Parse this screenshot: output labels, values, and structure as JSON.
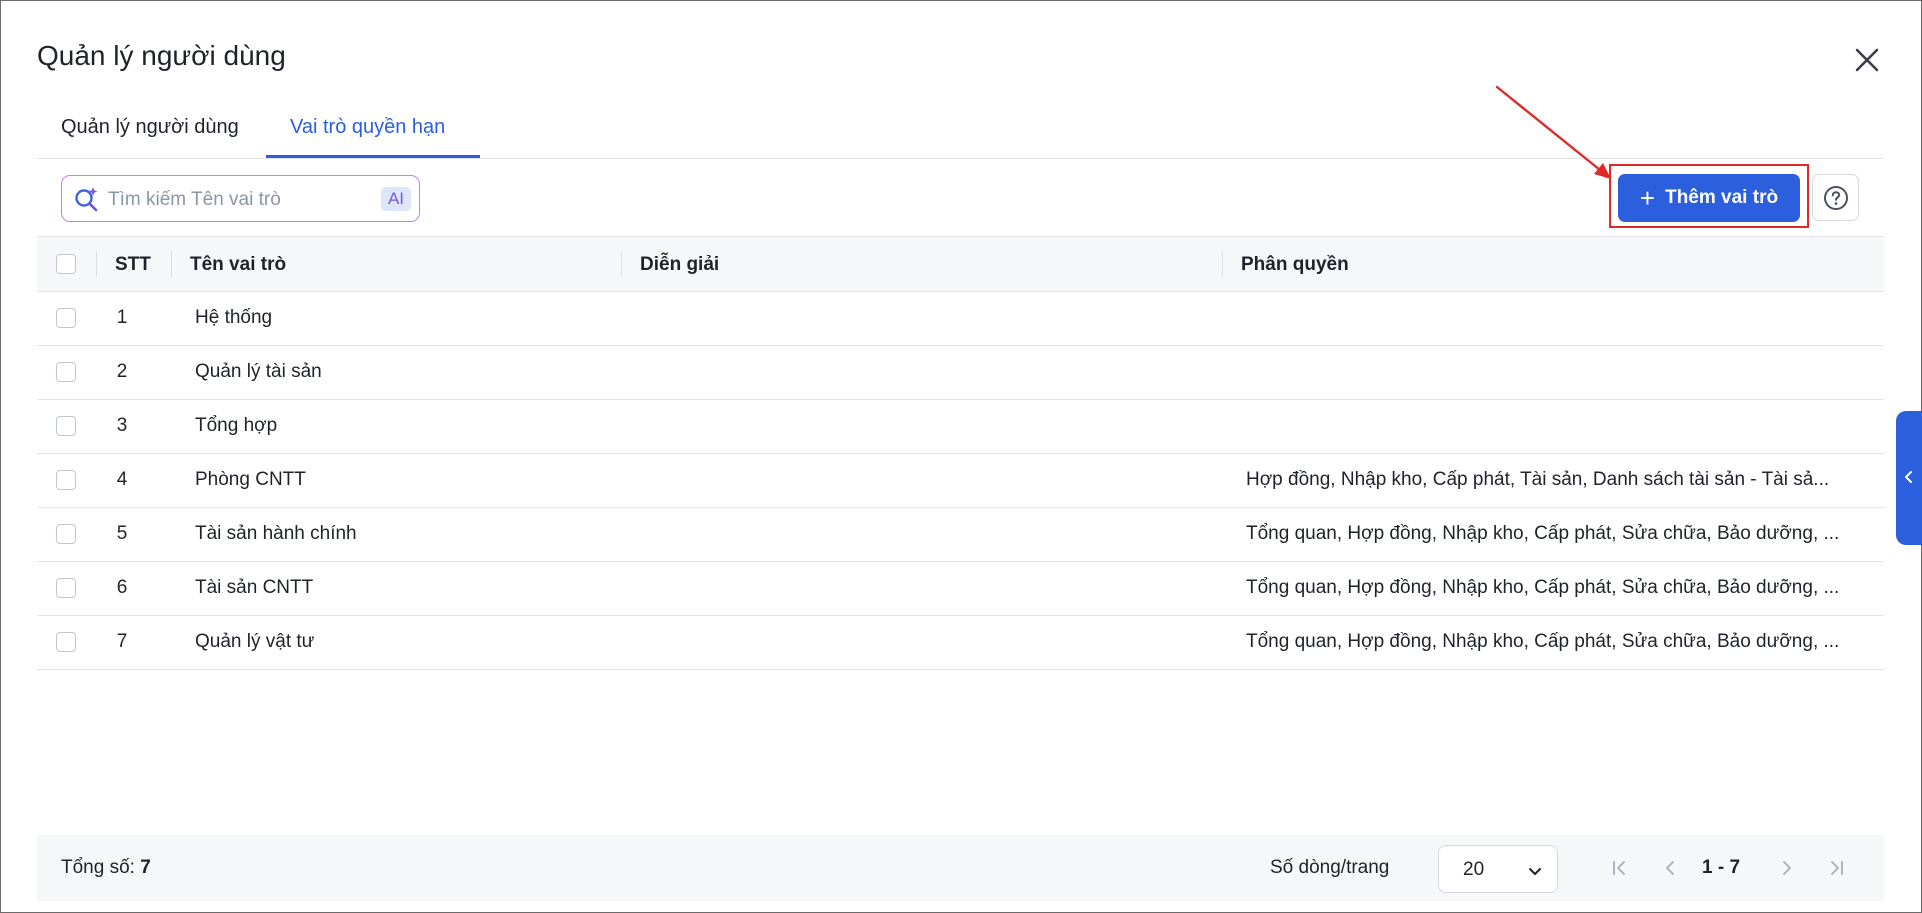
{
  "dialog": {
    "title": "Quản lý người dùng"
  },
  "tabs": [
    {
      "label": "Quản lý người dùng",
      "active": false
    },
    {
      "label": "Vai trò quyền hạn",
      "active": true
    }
  ],
  "search": {
    "placeholder": "Tìm kiếm Tên vai trò",
    "value": "",
    "ai_badge": "AI"
  },
  "toolbar": {
    "add_label": "Thêm vai trò",
    "help_icon": "question-circle-icon"
  },
  "table": {
    "columns": [
      "STT",
      "Tên vai trò",
      "Diễn giải",
      "Phân quyền"
    ],
    "rows": [
      {
        "stt": "1",
        "name": "Hệ thống",
        "description": "",
        "permissions": ""
      },
      {
        "stt": "2",
        "name": "Quản lý tài sản",
        "description": "",
        "permissions": ""
      },
      {
        "stt": "3",
        "name": "Tổng hợp",
        "description": "",
        "permissions": ""
      },
      {
        "stt": "4",
        "name": "Phòng CNTT",
        "description": "",
        "permissions": "Hợp đồng, Nhập kho, Cấp phát, Tài sản, Danh sách tài sản - Tài sả..."
      },
      {
        "stt": "5",
        "name": "Tài sản hành chính",
        "description": "",
        "permissions": "Tổng quan, Hợp đồng, Nhập kho, Cấp phát, Sửa chữa, Bảo dưỡng, ..."
      },
      {
        "stt": "6",
        "name": "Tài sản CNTT",
        "description": "",
        "permissions": "Tổng quan, Hợp đồng, Nhập kho, Cấp phát, Sửa chữa, Bảo dưỡng, ..."
      },
      {
        "stt": "7",
        "name": "Quản lý vật tư",
        "description": "",
        "permissions": "Tổng quan, Hợp đồng, Nhập kho, Cấp phát, Sửa chữa, Bảo dưỡng, ..."
      }
    ]
  },
  "footer": {
    "total_label": "Tổng số:",
    "total_value": "7",
    "rows_per_page_label": "Số dòng/trang",
    "rows_per_page": "20",
    "page_range": "1 - 7"
  },
  "colors": {
    "accent": "#2b5fde",
    "annotation": "#e02a2a",
    "search_border": "#c77ff0"
  }
}
